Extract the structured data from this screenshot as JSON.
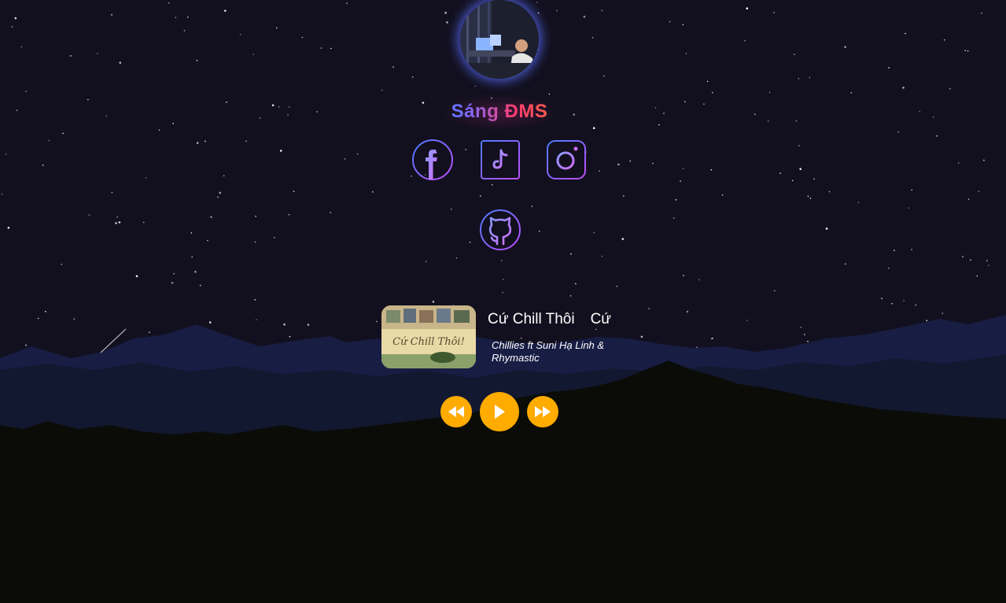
{
  "profile": {
    "name": "Sáng ĐMS",
    "avatar_icon": "avatar-photo"
  },
  "socials": [
    {
      "name": "facebook",
      "icon": "facebook-icon"
    },
    {
      "name": "tiktok",
      "icon": "tiktok-icon"
    },
    {
      "name": "instagram",
      "icon": "instagram-icon"
    },
    {
      "name": "github",
      "icon": "github-icon"
    }
  ],
  "player": {
    "title": "Cứ Chill Thôi",
    "title_repeat": "Cứ",
    "artist": "Chillies ft Suni Hạ Linh & Rhymastic",
    "cover_text": "Cứ Chill Thôi!",
    "controls": {
      "prev_icon": "rewind-icon",
      "play_icon": "play-icon",
      "next_icon": "fast-forward-icon"
    }
  },
  "colors": {
    "background": "#12101e",
    "control_accent": "#ffab00",
    "icon_gradient_start": "#5b6bff",
    "icon_gradient_end": "#c04dff"
  }
}
